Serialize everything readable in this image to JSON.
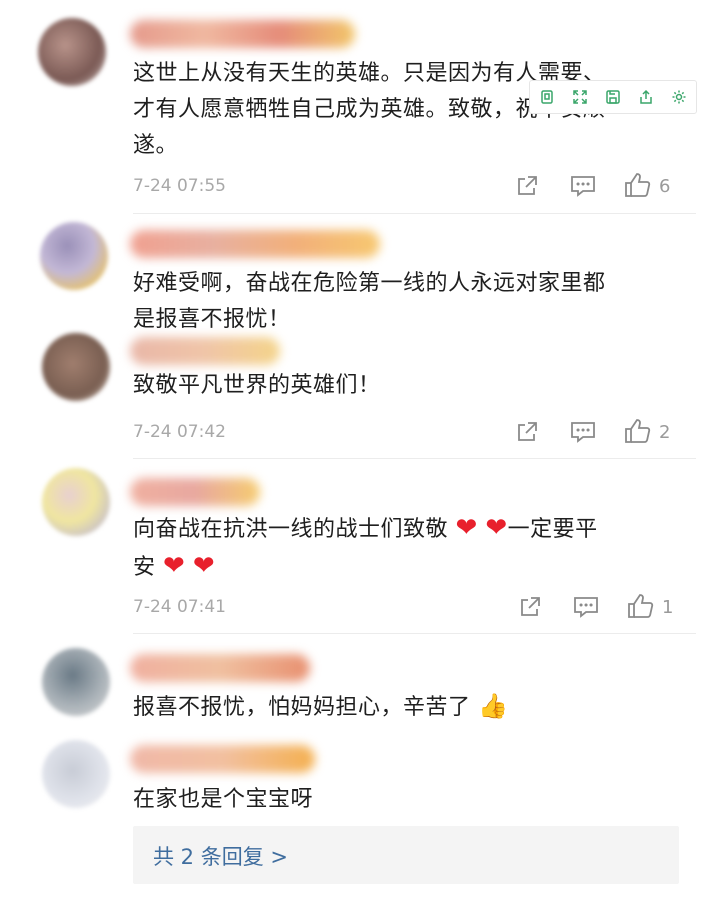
{
  "comments": [
    {
      "text_line1": "这世上从没有天生的英雄。只是因为有人需要、",
      "text_line2": "才有人愿意牺牲自己成为英雄。致敬，祝平安顺",
      "text_line3": "遂。",
      "time": "7-24 07:55",
      "likes": "6"
    },
    {
      "text_line1": "好难受啊，奋战在危险第一线的人永远对家里都",
      "text_line2": "是报喜不报忧！",
      "reply_text": "致敬平凡世界的英雄们！",
      "time": "7-24 07:42",
      "likes": "2"
    },
    {
      "text_line1_a": "向奋战在抗洪一线的战士们致敬",
      "text_line1_b": "一定要平",
      "text_line2": "安",
      "heart": "❤",
      "time": "7-24 07:41",
      "likes": "1"
    },
    {
      "text": "报喜不报忧，怕妈妈担心，辛苦了",
      "emoji": "👍",
      "reply_text": "在家也是个宝宝呀"
    }
  ],
  "reply_summary": "共 2 条回复 >",
  "colors": {
    "link": "#3f6d9e",
    "meta": "#a8a8a8",
    "heart": "#e8202c"
  }
}
